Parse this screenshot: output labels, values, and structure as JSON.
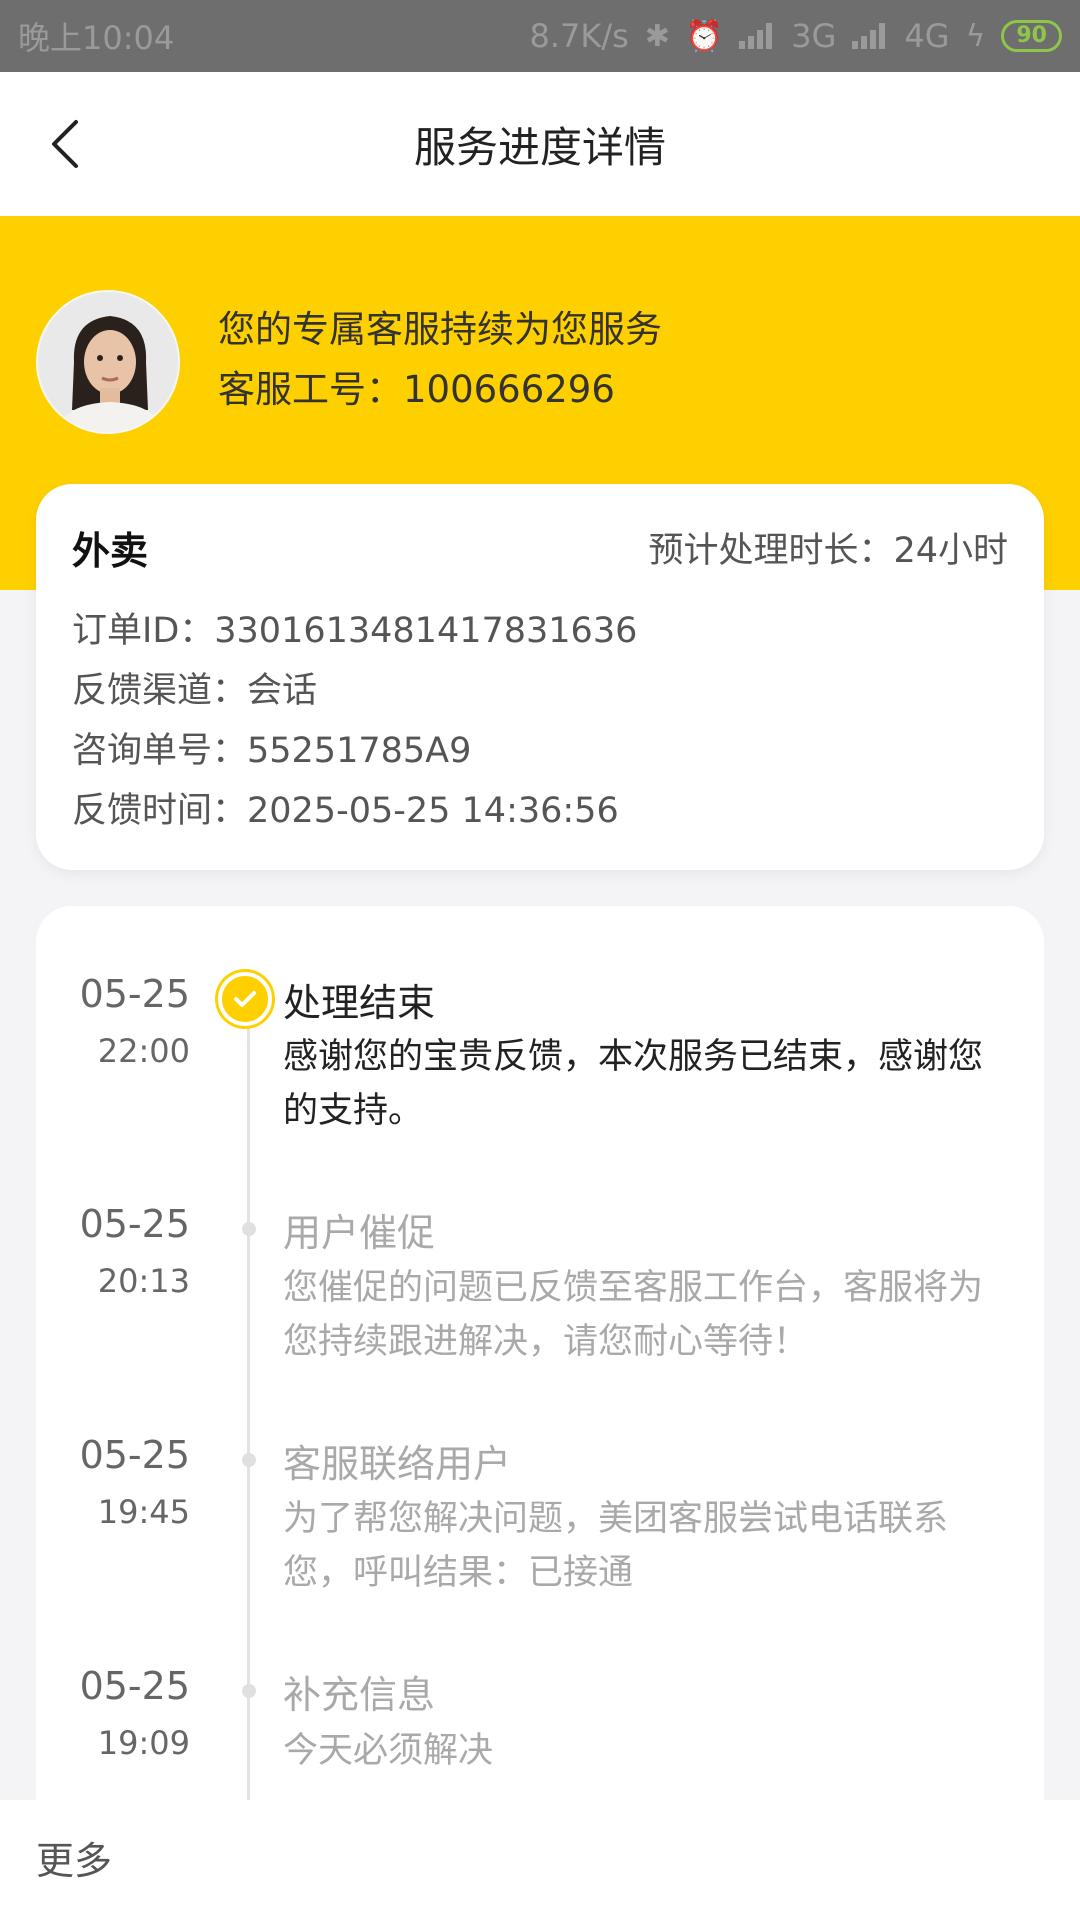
{
  "status_bar": {
    "time": "晚上10:04",
    "network_speed": "8.7K/s",
    "net_3g": "3G",
    "net_4g": "4G",
    "battery": "90",
    "icons": [
      "bluetooth-icon",
      "alarm-icon",
      "signal-icon",
      "signal-icon",
      "charging-icon"
    ]
  },
  "navbar": {
    "title": "服务进度详情",
    "back_icon": "chevron-left-icon"
  },
  "agent": {
    "line1": "您的专属客服持续为您服务",
    "line2": "客服工号：100666296"
  },
  "info_card": {
    "type": "外卖",
    "duration": "预计处理时长：24小时",
    "order_id": "订单ID：3301613481417831636",
    "channel": "反馈渠道：会话",
    "inquiry_no": "咨询单号：55251785A9",
    "feedback_time": "反馈时间：2025-05-25 14:36:56"
  },
  "timeline": [
    {
      "date": "05-25",
      "time": "22:00",
      "title": "处理结束",
      "desc": "感谢您的宝贵反馈，本次服务已结束，感谢您的支持。",
      "status": "done"
    },
    {
      "date": "05-25",
      "time": "20:13",
      "title": "用户催促",
      "desc": "您催促的问题已反馈至客服工作台，客服将为您持续跟进解决，请您耐心等待！",
      "status": "past"
    },
    {
      "date": "05-25",
      "time": "19:45",
      "title": "客服联络用户",
      "desc": "为了帮您解决问题，美团客服尝试电话联系您，呼叫结果：已接通",
      "status": "past"
    },
    {
      "date": "05-25",
      "time": "19:09",
      "title": "补充信息",
      "desc": "今天必须解决",
      "status": "past"
    }
  ],
  "footer": {
    "more": "更多"
  },
  "colors": {
    "accent": "#ffd000",
    "status_bar": "#6e6e6e",
    "muted_text": "#a9a9a9"
  }
}
